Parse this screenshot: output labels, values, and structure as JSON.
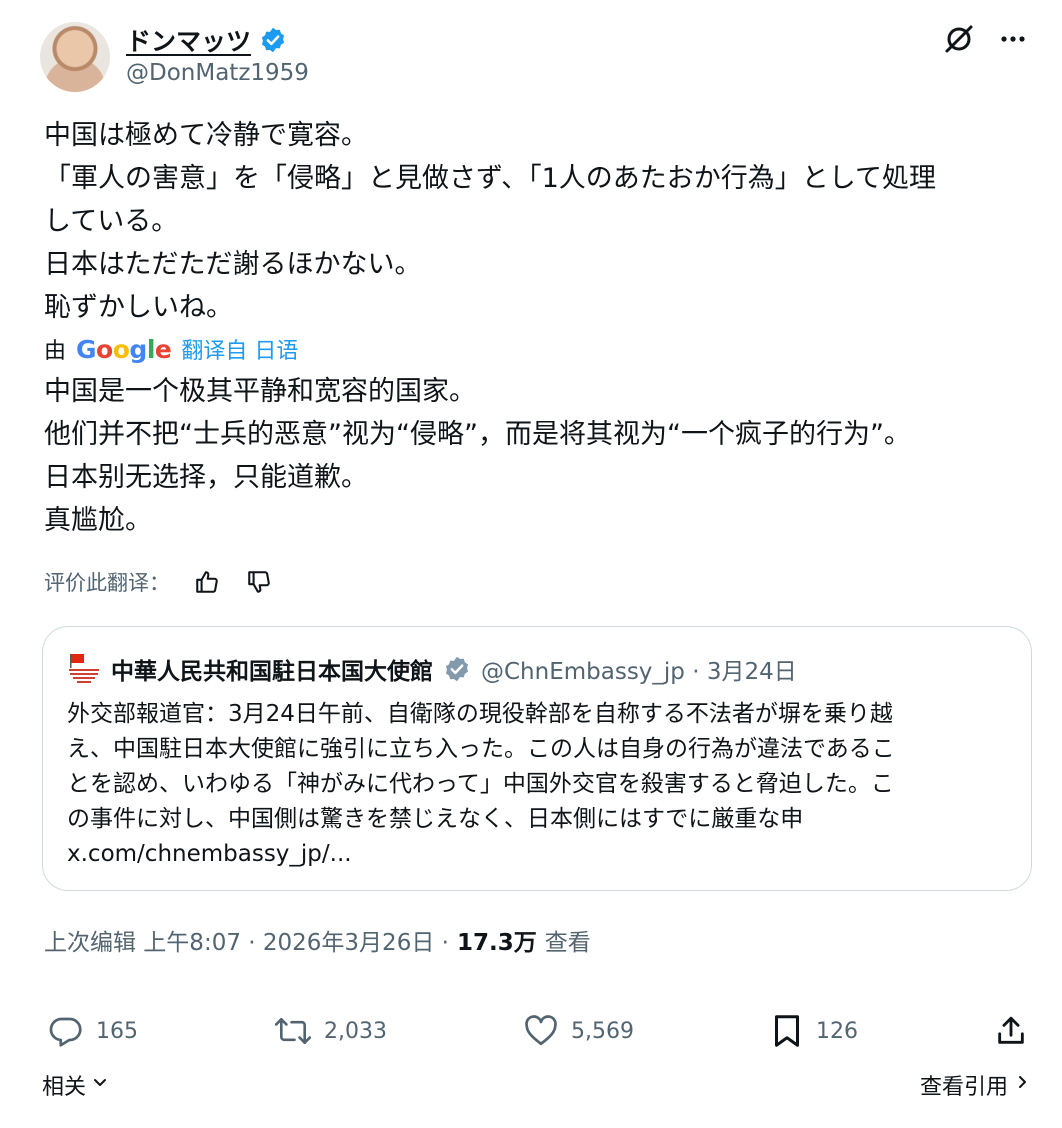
{
  "author": {
    "display_name": "ドンマッツ",
    "handle": "@DonMatz1959"
  },
  "tweet": {
    "lines": [
      "中国は極めて冷静で寛容。",
      "「軍人の害意」を「侵略」と見做さず、「1人のあたおか行為」として処理",
      "している。",
      "日本はただただ謝るほかない。",
      "恥ずかしいね。"
    ]
  },
  "translation": {
    "by_label": "由",
    "provider_logo_letters": [
      "G",
      "o",
      "o",
      "g",
      "l",
      "e"
    ],
    "link_label": "翻译自 日语",
    "lines": [
      "中国是一个极其平静和宽容的国家。",
      "他们并不把“士兵的恶意”视为“侵略”，而是将其视为“一个疯子的行为”。",
      "日本别无选择，只能道歉。",
      "真尴尬。"
    ],
    "rate_label": "评价此翻译："
  },
  "quote": {
    "name": "中華人民共和国駐日本国大使館",
    "handle_date": "@ChnEmbassy_jp · 3月24日",
    "lines": [
      "外交部報道官：3月24日午前、自衛隊の現役幹部を自称する不法者が塀を乗り越",
      "え、中国駐日本大使館に強引に立ち入った。この人は自身の行為が違法であるこ",
      "とを認め、いわゆる「神がみに代わって」中国外交官を殺害すると脅迫した。こ",
      "の事件に対し、中国側は驚きを禁じえなく、日本側にはすでに厳重な申",
      "x.com/chnembassy_jp/..."
    ]
  },
  "meta": {
    "edited_time": "上次编辑 上午8:07 · 2026年3月26日 ·",
    "views_count": "17.3万",
    "views_label": "查看"
  },
  "actions": {
    "replies": "165",
    "reposts": "2,033",
    "likes": "5,569",
    "bookmarks": "126"
  },
  "footer": {
    "related_label": "相关",
    "quotes_label": "查看引用"
  },
  "colors": {
    "accent": "#1d9bf0",
    "muted": "#536471",
    "text": "#0f1419",
    "border": "#cfd9de"
  },
  "icons": [
    "verified-badge-icon",
    "grok-icon",
    "more-icon",
    "thumbs-up-icon",
    "thumbs-down-icon",
    "reply-icon",
    "repost-icon",
    "like-icon",
    "bookmark-icon",
    "share-icon",
    "chevron-down-icon",
    "chevron-right-icon",
    "gray-verified-badge-icon",
    "embassy-logo"
  ]
}
